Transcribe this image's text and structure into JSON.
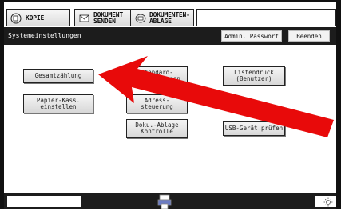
{
  "tabs": {
    "kopie": "KOPIE",
    "senden_line1": "DOKUMENT",
    "senden_line2": "SENDEN",
    "ablage_line1": "DOKUMENTEN-",
    "ablage_line2": "ABLAGE"
  },
  "header": {
    "title": "Systemeinstellungen",
    "admin_button": "Admin. Passwort",
    "exit_button": "Beenden"
  },
  "functions": {
    "gesamtzaehlung": "Gesamtzählung",
    "standard_partial": "Standard-\neinstellungen",
    "listendruck": "Listendruck\n(Benutzer)",
    "papier": "Papier-Kass.\neinstellen",
    "adress_partial": "Adress-\nsteuerung",
    "dokuablage": "Doku.-Ablage\nKontrolle",
    "usb": "USB-Gerät prüfen"
  },
  "colors": {
    "arrow": "#e80a0a",
    "frame": "#1c1c1c"
  },
  "icons": {
    "kopie": "copy-icon",
    "senden": "send-icon",
    "ablage": "filing-icon",
    "status": "printer-status-icon",
    "sun": "brightness-icon"
  }
}
